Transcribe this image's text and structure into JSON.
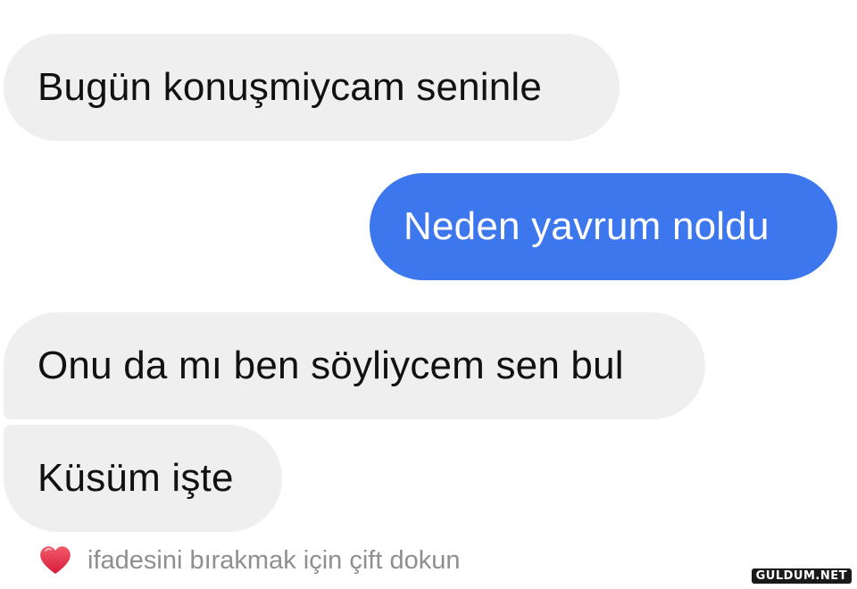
{
  "messages": [
    {
      "direction": "incoming",
      "text": "Bugün konuşmiycam seninle"
    },
    {
      "direction": "outgoing",
      "text": "Neden yavrum noldu"
    },
    {
      "direction": "incoming",
      "text": "Onu da mı ben söyliycem sen bul"
    },
    {
      "direction": "incoming",
      "text": "Küsüm işte"
    }
  ],
  "reaction_hint": {
    "icon": "heart-icon",
    "icon_color": "#e0245e",
    "text": "ifadesini bırakmak için çift dokun"
  },
  "colors": {
    "incoming_bubble": "#efefef",
    "outgoing_bubble": "#3d77ee",
    "incoming_text": "#111111",
    "outgoing_text": "#ffffff",
    "hint_text": "#8e8e93"
  },
  "watermark": "GULDUM.NET"
}
